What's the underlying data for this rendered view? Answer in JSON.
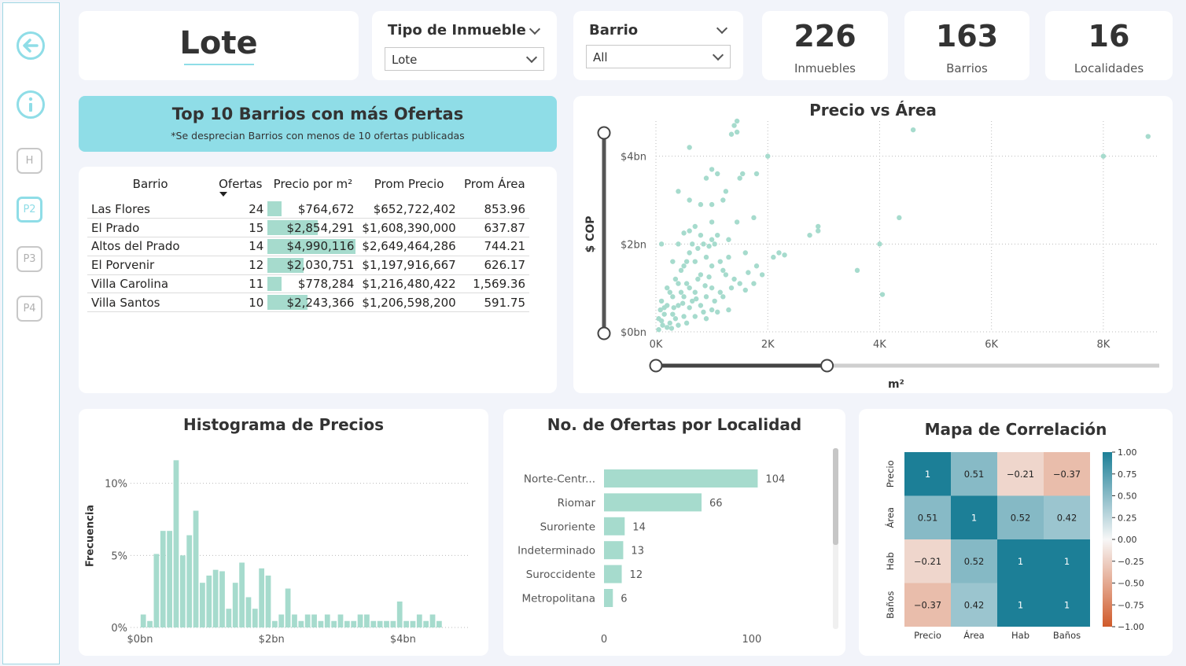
{
  "sidebar": {
    "items": [
      {
        "label": "H",
        "active": false
      },
      {
        "label": "P2",
        "active": true
      },
      {
        "label": "P3",
        "active": false
      },
      {
        "label": "P4",
        "active": false
      }
    ],
    "back_icon": "arrow-left-icon",
    "info_icon": "info-icon"
  },
  "header": {
    "title": "Lote"
  },
  "slicers": {
    "tipo": {
      "title": "Tipo de Inmueble",
      "value": "Lote"
    },
    "barrio": {
      "title": "Barrio",
      "value": "All"
    }
  },
  "kpis": [
    {
      "value": "226",
      "label": "Inmuebles"
    },
    {
      "value": "163",
      "label": "Barrios"
    },
    {
      "value": "16",
      "label": "Localidades"
    }
  ],
  "top10": {
    "title": "Top 10 Barrios con más Ofertas",
    "subtitle": "*Se desprecian Barrios con menos de 10 ofertas publicadas",
    "columns": [
      "Barrio",
      "Ofertas",
      "Precio por m²",
      "Prom Precio",
      "Prom Área"
    ],
    "rows": [
      {
        "barrio": "Las Flores",
        "ofertas": "24",
        "ppm": "$764,672",
        "ppm_value": 764672,
        "precio": "$652,722,402",
        "area": "853.96"
      },
      {
        "barrio": "El Prado",
        "ofertas": "15",
        "ppm": "$2,854,291",
        "ppm_value": 2854291,
        "precio": "$1,608,390,000",
        "area": "637.87"
      },
      {
        "barrio": "Altos del Prado",
        "ofertas": "14",
        "ppm": "$4,990,116",
        "ppm_value": 4990116,
        "precio": "$2,649,464,286",
        "area": "744.21"
      },
      {
        "barrio": "El Porvenir",
        "ofertas": "12",
        "ppm": "$2,030,751",
        "ppm_value": 2030751,
        "precio": "$1,197,916,667",
        "area": "626.17"
      },
      {
        "barrio": "Villa Carolina",
        "ofertas": "11",
        "ppm": "$778,284",
        "ppm_value": 778284,
        "precio": "$1,216,480,422",
        "area": "1,569.36"
      },
      {
        "barrio": "Villa Santos",
        "ofertas": "10",
        "ppm": "$2,243,366",
        "ppm_value": 2243366,
        "precio": "$1,206,598,200",
        "area": "591.75"
      }
    ]
  },
  "colors": {
    "accent": "#8fdde7",
    "bar": "#a6dbcd",
    "heat_high": "#1c7f97",
    "heat_low": "#d05a2a"
  },
  "chart_data": [
    {
      "type": "scatter",
      "title": "Precio vs Área",
      "xlabel": "m²",
      "ylabel": "$ COP",
      "xlim": [
        0,
        9000
      ],
      "ylim": [
        0,
        4.8
      ],
      "xticks": [
        "0K",
        "2K",
        "4K",
        "6K",
        "8K"
      ],
      "xtick_values": [
        0,
        2000,
        4000,
        6000,
        8000
      ],
      "yticks": [
        "$0bn",
        "$2bn",
        "$4bn"
      ],
      "ytick_values": [
        0,
        2,
        4
      ],
      "y_unit": "bn",
      "x_slider_range": [
        0,
        3000
      ],
      "points": [
        [
          1450,
          4.8
        ],
        [
          1400,
          4.7
        ],
        [
          1350,
          4.5
        ],
        [
          1450,
          4.55
        ],
        [
          4600,
          4.6
        ],
        [
          8800,
          4.45
        ],
        [
          600,
          4.2
        ],
        [
          2000,
          4.0
        ],
        [
          8000,
          4.0
        ],
        [
          1000,
          3.7
        ],
        [
          1100,
          3.6
        ],
        [
          1500,
          3.5
        ],
        [
          1550,
          3.6
        ],
        [
          1800,
          3.6
        ],
        [
          900,
          3.5
        ],
        [
          1250,
          3.2
        ],
        [
          400,
          3.2
        ],
        [
          600,
          3.0
        ],
        [
          1200,
          3.0
        ],
        [
          800,
          2.9
        ],
        [
          1000,
          2.9
        ],
        [
          4350,
          2.6
        ],
        [
          1450,
          2.5
        ],
        [
          1750,
          2.6
        ],
        [
          2900,
          2.4
        ],
        [
          2900,
          2.3
        ],
        [
          2750,
          2.2
        ],
        [
          1000,
          2.5
        ],
        [
          700,
          2.4
        ],
        [
          500,
          2.25
        ],
        [
          600,
          2.3
        ],
        [
          800,
          2.2
        ],
        [
          1000,
          2.1
        ],
        [
          1100,
          2.2
        ],
        [
          100,
          2.0
        ],
        [
          400,
          2.0
        ],
        [
          650,
          2.0
        ],
        [
          850,
          2.0
        ],
        [
          1050,
          2.0
        ],
        [
          4000,
          2.0
        ],
        [
          2100,
          1.7
        ],
        [
          2200,
          1.8
        ],
        [
          2300,
          1.75
        ],
        [
          1300,
          1.7
        ],
        [
          1600,
          1.8
        ],
        [
          900,
          1.7
        ],
        [
          700,
          1.6
        ],
        [
          1000,
          1.5
        ],
        [
          300,
          1.6
        ],
        [
          500,
          1.5
        ],
        [
          1800,
          1.5
        ],
        [
          1650,
          1.35
        ],
        [
          800,
          1.3
        ],
        [
          1200,
          1.4
        ],
        [
          1400,
          1.2
        ],
        [
          1500,
          1.1
        ],
        [
          3600,
          1.4
        ],
        [
          1900,
          1.3
        ],
        [
          1000,
          1.0
        ],
        [
          600,
          1.0
        ],
        [
          400,
          1.1
        ],
        [
          200,
          1.0
        ],
        [
          700,
          0.9
        ],
        [
          300,
          0.8
        ],
        [
          500,
          0.8
        ],
        [
          900,
          0.8
        ],
        [
          1200,
          0.8
        ],
        [
          4050,
          0.85
        ],
        [
          100,
          0.7
        ],
        [
          200,
          0.6
        ],
        [
          400,
          0.6
        ],
        [
          600,
          0.55
        ],
        [
          800,
          0.6
        ],
        [
          1000,
          0.5
        ],
        [
          1100,
          0.45
        ],
        [
          1300,
          0.5
        ],
        [
          150,
          0.4
        ],
        [
          300,
          0.4
        ],
        [
          500,
          0.35
        ],
        [
          700,
          0.35
        ],
        [
          900,
          0.3
        ],
        [
          100,
          0.25
        ],
        [
          250,
          0.2
        ],
        [
          400,
          0.15
        ],
        [
          550,
          0.2
        ],
        [
          200,
          0.1
        ],
        [
          50,
          0.05
        ],
        [
          350,
          0.3
        ],
        [
          650,
          0.7
        ],
        [
          750,
          1.2
        ],
        [
          950,
          1.25
        ],
        [
          550,
          1.1
        ],
        [
          450,
          0.9
        ],
        [
          350,
          1.2
        ],
        [
          150,
          0.55
        ],
        [
          50,
          0.3
        ],
        [
          120,
          0.15
        ],
        [
          280,
          0.08
        ],
        [
          850,
          0.45
        ],
        [
          1050,
          0.7
        ],
        [
          1150,
          0.9
        ],
        [
          1350,
          1.0
        ],
        [
          600,
          1.8
        ],
        [
          450,
          1.4
        ],
        [
          750,
          1.9
        ],
        [
          1150,
          1.6
        ],
        [
          950,
          1.95
        ],
        [
          1300,
          2.1
        ],
        [
          550,
          1.6
        ],
        [
          250,
          0.9
        ],
        [
          80,
          0.5
        ],
        [
          320,
          0.55
        ],
        [
          480,
          0.65
        ],
        [
          720,
          0.75
        ],
        [
          880,
          1.05
        ],
        [
          1600,
          0.95
        ],
        [
          1750,
          1.1
        ],
        [
          1250,
          1.3
        ]
      ]
    },
    {
      "type": "bar",
      "title": "Histograma de Precios",
      "xlabel": "",
      "ylabel": "Frecuencia",
      "ylim": [
        0,
        12
      ],
      "xticks": [
        "$0bn",
        "$2bn",
        "$4bn"
      ],
      "xtick_values": [
        0,
        2,
        4
      ],
      "yticks": [
        "0%",
        "5%",
        "10%"
      ],
      "ytick_values": [
        0,
        5,
        10
      ],
      "xlim": [
        0,
        5
      ],
      "bin_width": 0.1,
      "values": [
        0.9,
        0.45,
        5.1,
        6.7,
        6.7,
        11.6,
        5.0,
        6.4,
        8.1,
        3.1,
        3.6,
        4.0,
        3.9,
        1.3,
        3.1,
        4.5,
        2.1,
        1.3,
        4.1,
        3.6,
        0.45,
        0.9,
        2.7,
        0.9,
        0.45,
        0.9,
        0.9,
        0.45,
        0.9,
        0.45,
        0.9,
        0.45,
        0.45,
        0.9,
        0.9,
        0.45,
        0.45,
        0.45,
        0.45,
        1.8,
        0.45,
        0.45,
        0.9,
        0.45,
        0.9,
        0.45
      ]
    },
    {
      "type": "bar",
      "title": "No. de Ofertas por Localidad",
      "orientation": "horizontal",
      "categories": [
        "Norte-Centr...",
        "Riomar",
        "Suroriente",
        "Indeterminado",
        "Suroccidente",
        "Metropolitana"
      ],
      "values": [
        104,
        66,
        14,
        13,
        12,
        6
      ],
      "xlim": [
        0,
        120
      ],
      "xticks": [
        "0",
        "100"
      ],
      "xtick_values": [
        0,
        100
      ]
    },
    {
      "type": "heatmap",
      "title": "Mapa de Correlación",
      "labels": [
        "Precio",
        "Área",
        "Hab",
        "Baños"
      ],
      "values": [
        [
          1,
          0.51,
          -0.21,
          -0.37
        ],
        [
          0.51,
          1,
          0.52,
          0.42
        ],
        [
          -0.21,
          0.52,
          1,
          1
        ],
        [
          -0.37,
          0.42,
          1,
          1
        ]
      ],
      "cell_text": [
        [
          "1",
          "0.51",
          "−0.21",
          "−0.37"
        ],
        [
          "0.51",
          "1",
          "0.52",
          "0.42"
        ],
        [
          "−0.21",
          "0.52",
          "1",
          "1"
        ],
        [
          "−0.37",
          "0.42",
          "1",
          "1"
        ]
      ],
      "colorbar_ticks": [
        "1.00",
        "0.75",
        "0.50",
        "0.25",
        "0.00",
        "−0.25",
        "−0.50",
        "−0.75",
        "−1.00"
      ],
      "colorbar_values": [
        1,
        0.75,
        0.5,
        0.25,
        0,
        -0.25,
        -0.5,
        -0.75,
        -1
      ]
    }
  ]
}
